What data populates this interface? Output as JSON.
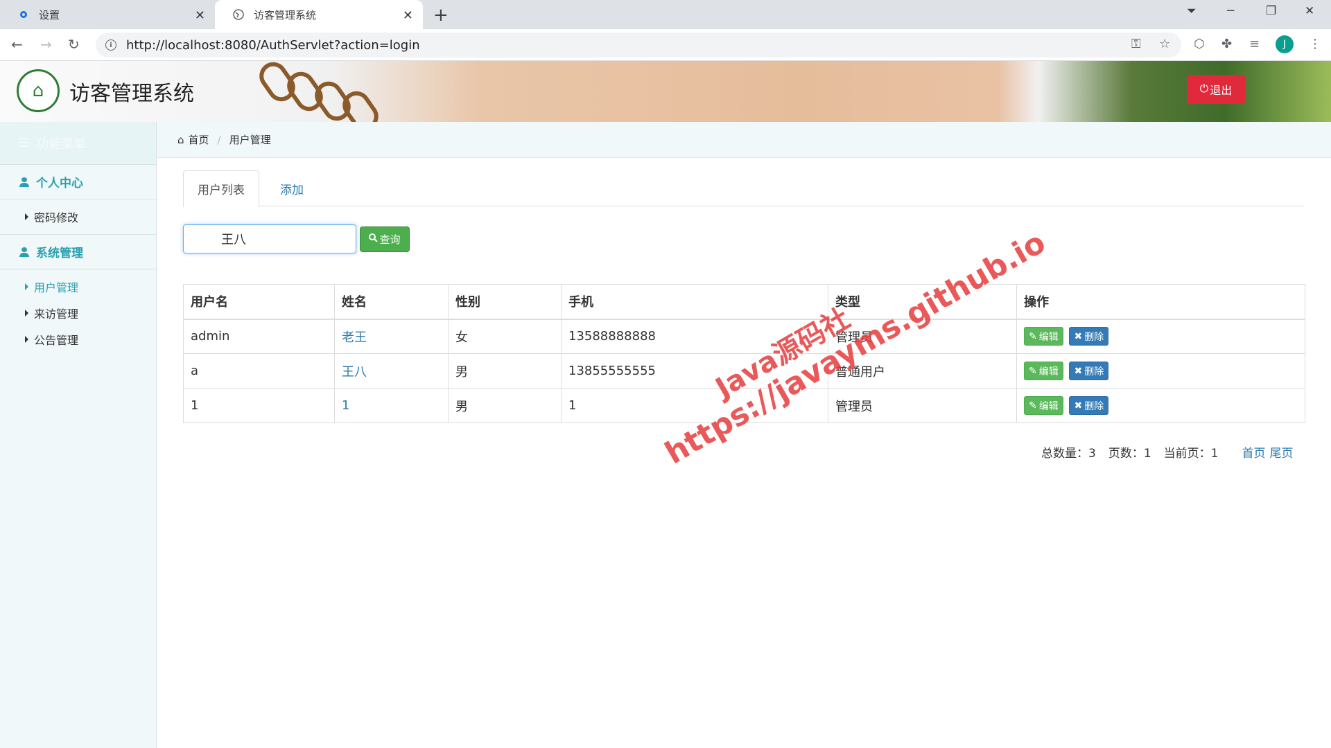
{
  "browser": {
    "tabs": [
      {
        "title": "设置",
        "icon": "gear-icon"
      },
      {
        "title": "访客管理系统",
        "icon": "globe-icon"
      }
    ],
    "url": "http://localhost:8080/AuthServlet?action=login",
    "profile_initial": "J"
  },
  "header": {
    "title": "访客管理系统",
    "logout_label": "退出"
  },
  "sidebar": {
    "head_label": "功能菜单",
    "groups": [
      {
        "label": "个人中心",
        "items": [
          "密码修改"
        ]
      },
      {
        "label": "系统管理",
        "items": [
          "用户管理",
          "来访管理",
          "公告管理"
        ]
      }
    ],
    "active_item": "用户管理"
  },
  "breadcrumb": {
    "home": "首页",
    "current": "用户管理"
  },
  "tabs": {
    "list": "用户列表",
    "add": "添加"
  },
  "search": {
    "value": "王八",
    "button_label": "查询"
  },
  "table": {
    "headers": [
      "用户名",
      "姓名",
      "性别",
      "手机",
      "类型",
      "操作"
    ],
    "rows": [
      {
        "username": "admin",
        "name": "老王",
        "gender": "女",
        "phone": "13588888888",
        "type": "管理员"
      },
      {
        "username": "a",
        "name": "王八",
        "gender": "男",
        "phone": "13855555555",
        "type": "普通用户"
      },
      {
        "username": "1",
        "name": "1",
        "gender": "男",
        "phone": "1",
        "type": "管理员"
      }
    ],
    "edit_label": "编辑",
    "delete_label": "删除"
  },
  "pagination": {
    "total": "总数量：3",
    "pages": "页数：1",
    "current": "当前页：1",
    "first": "首页",
    "last": "尾页"
  },
  "watermark": {
    "line1": "Java源码社",
    "line2": "https://javayms.github.io"
  },
  "colors": {
    "accent": "#2a9fb0",
    "logout": "#e02a3b",
    "search_button": "#4cae4c",
    "edit_button": "#5cb85c",
    "delete_button": "#337ab7"
  }
}
